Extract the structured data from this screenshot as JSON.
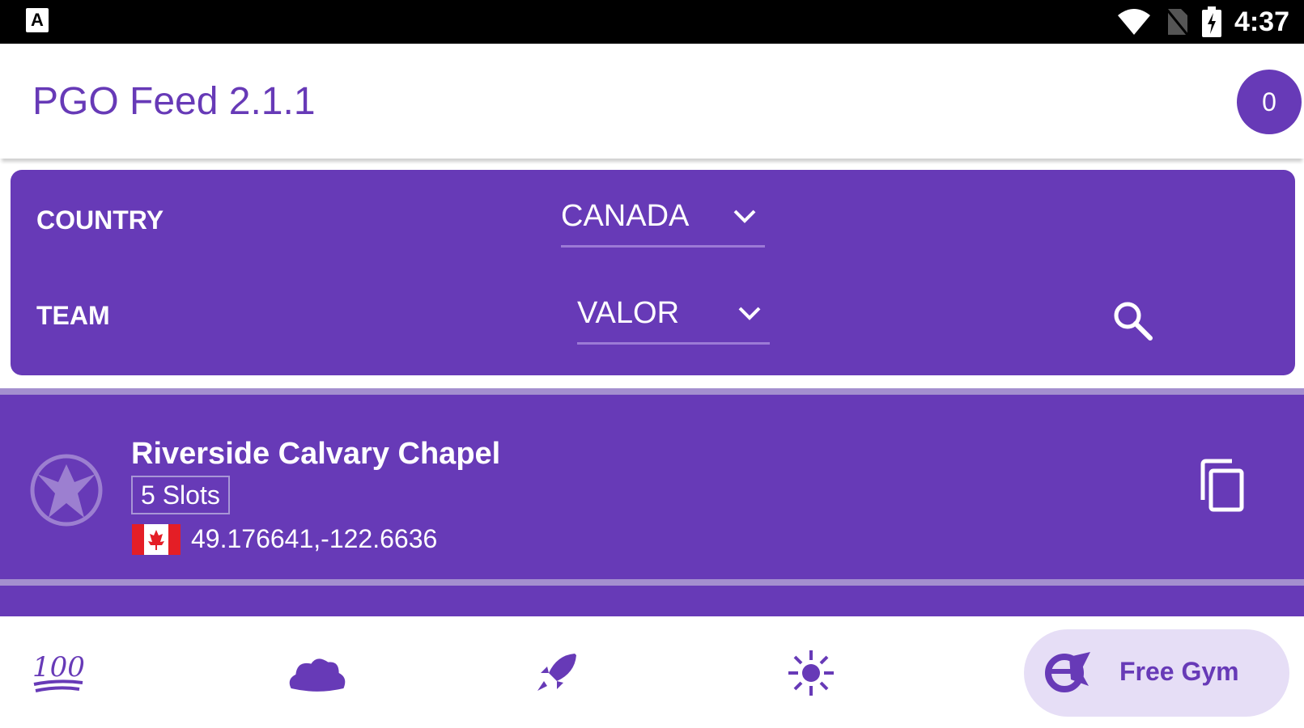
{
  "status_bar": {
    "notification_icon": "A",
    "time": "4:37",
    "icons": [
      "wifi-icon",
      "no-sim-icon",
      "battery-charging-icon"
    ]
  },
  "header": {
    "title": "PGO Feed 2.1.1",
    "counter": "0"
  },
  "filters": {
    "country_label": "COUNTRY",
    "country_value": "CANADA",
    "team_label": "TEAM",
    "team_value": "VALOR",
    "search_icon": "search-icon"
  },
  "gyms": [
    {
      "name": "Riverside Calvary Chapel",
      "slots": "5 Slots",
      "flag": "canada-flag",
      "coords": "49.176641,-122.6636",
      "team_icon": "valor-icon",
      "action_icon": "copy-icon"
    }
  ],
  "bottom_nav": {
    "items": [
      {
        "icon": "hundred-icon"
      },
      {
        "icon": "blob-icon"
      },
      {
        "icon": "rocket-icon"
      },
      {
        "icon": "sparkle-icon"
      }
    ],
    "active": {
      "icon": "free-gym-icon",
      "label": "Free Gym"
    }
  },
  "colors": {
    "primary": "#673ab7",
    "active_pill": "#e6def6",
    "separator": "#a48fcf"
  }
}
